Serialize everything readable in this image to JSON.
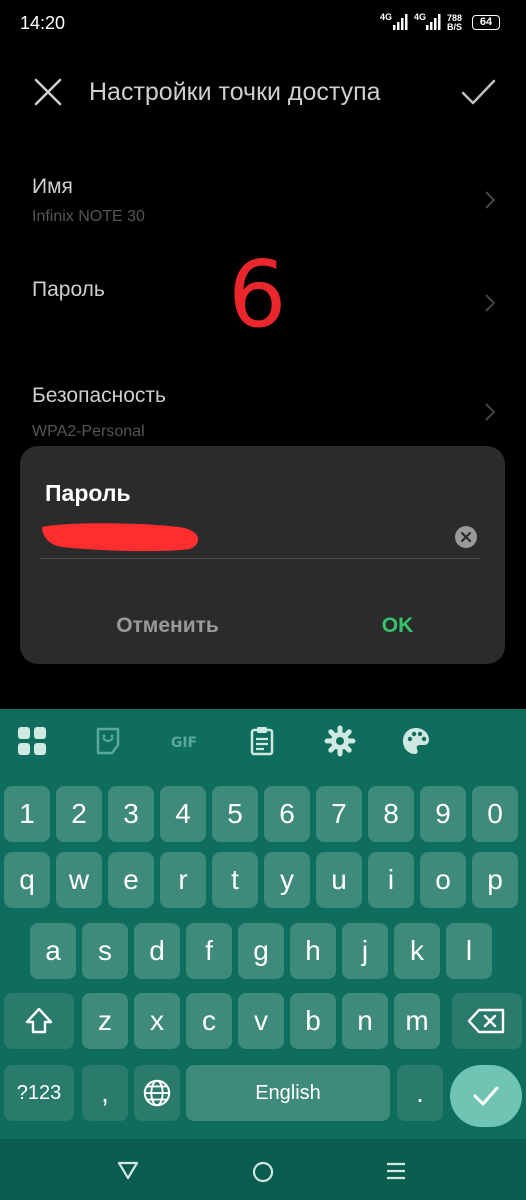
{
  "status_bar": {
    "time": "14:20",
    "network1": "4G",
    "network2": "4G",
    "speed_top": "788",
    "speed_bottom": "B/S",
    "battery": "64"
  },
  "header": {
    "title": "Настройки точки доступа",
    "close_icon": "close-icon",
    "confirm_icon": "check-icon"
  },
  "settings": [
    {
      "title": "Имя",
      "subtitle": "Infinix NOTE 30"
    },
    {
      "title": "Пароль",
      "subtitle": ""
    },
    {
      "title": "Безопасность",
      "subtitle": "WPA2-Personal"
    }
  ],
  "overlay_digit": "6",
  "dialog": {
    "title": "Пароль",
    "password_value": "",
    "cancel_label": "Отменить",
    "ok_label": "OK"
  },
  "keyboard": {
    "toolbar": [
      "grid-icon",
      "sticker-icon",
      "gif-icon",
      "clipboard-icon",
      "gear-icon",
      "palette-icon"
    ],
    "number_row": [
      "1",
      "2",
      "3",
      "4",
      "5",
      "6",
      "7",
      "8",
      "9",
      "0"
    ],
    "row1": [
      "q",
      "w",
      "e",
      "r",
      "t",
      "y",
      "u",
      "i",
      "o",
      "p"
    ],
    "row2": [
      "a",
      "s",
      "d",
      "f",
      "g",
      "h",
      "j",
      "k",
      "l"
    ],
    "row3": [
      "z",
      "x",
      "c",
      "v",
      "b",
      "n",
      "m"
    ],
    "symbols_label": "?123",
    "comma": ",",
    "period": ".",
    "space_label": "English",
    "colors": {
      "background": "#0e6d5d",
      "key": "#3e8a7b",
      "enter": "#6fc4b3"
    }
  },
  "colors": {
    "accent_ok": "#35c46c",
    "overlay_red": "#e8262c"
  }
}
